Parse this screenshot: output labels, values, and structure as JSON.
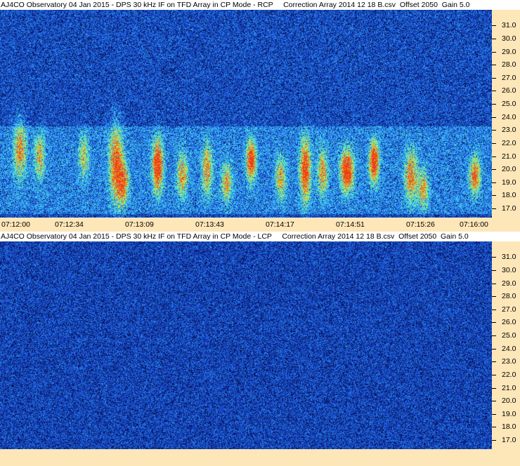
{
  "chart_data": [
    {
      "type": "heatmap",
      "title": "AJ4CO Observatory 04 Jan 2015 - DPS 30 kHz IF on TFD Array in CP Mode - RCP     Correction Array 2014 12 18 B.csv  Offset 2050  Gain 5.0",
      "xlabel": "",
      "ylabel": "",
      "x_ticks": [
        "07:12:00",
        "07:12:34",
        "07:13:09",
        "07:13:43",
        "07:14:17",
        "07:14:51",
        "07:15:26",
        "07:16:00"
      ],
      "y_ticks": [
        "31.0",
        "30.0",
        "29.0",
        "28.0",
        "27.0",
        "26.0",
        "25.0",
        "24.0",
        "23.0",
        "22.0",
        "21.0",
        "20.0",
        "19.0",
        "18.0",
        "17.0"
      ],
      "xlim": [
        "07:12:00",
        "07:16:00"
      ],
      "ylim": [
        16.3,
        32.2
      ],
      "colors": {
        "background": "#0c1a5e",
        "mid": "#1f6fe0",
        "high": "#46e3ff",
        "peak": "#f0b020"
      },
      "emission_band": [
        17.0,
        23.0
      ],
      "bursts": [
        {
          "t": 0.04,
          "f": 21.5,
          "strength": 0.6,
          "width": 0.012,
          "spread": 2.0
        },
        {
          "t": 0.08,
          "f": 21.0,
          "strength": 0.5,
          "width": 0.01,
          "spread": 1.6
        },
        {
          "t": 0.17,
          "f": 21.0,
          "strength": 0.45,
          "width": 0.01,
          "spread": 1.5
        },
        {
          "t": 0.235,
          "f": 20.5,
          "strength": 0.75,
          "width": 0.012,
          "spread": 2.6
        },
        {
          "t": 0.25,
          "f": 19.0,
          "strength": 0.65,
          "width": 0.01,
          "spread": 1.6
        },
        {
          "t": 0.32,
          "f": 20.3,
          "strength": 0.95,
          "width": 0.01,
          "spread": 1.8
        },
        {
          "t": 0.37,
          "f": 19.6,
          "strength": 0.6,
          "width": 0.01,
          "spread": 1.5
        },
        {
          "t": 0.42,
          "f": 20.0,
          "strength": 0.6,
          "width": 0.01,
          "spread": 1.8
        },
        {
          "t": 0.46,
          "f": 19.0,
          "strength": 0.55,
          "width": 0.01,
          "spread": 1.4
        },
        {
          "t": 0.51,
          "f": 20.7,
          "strength": 0.9,
          "width": 0.009,
          "spread": 1.4
        },
        {
          "t": 0.57,
          "f": 19.3,
          "strength": 0.55,
          "width": 0.01,
          "spread": 1.5
        },
        {
          "t": 0.62,
          "f": 20.0,
          "strength": 0.85,
          "width": 0.01,
          "spread": 2.2
        },
        {
          "t": 0.655,
          "f": 19.8,
          "strength": 0.6,
          "width": 0.01,
          "spread": 1.6
        },
        {
          "t": 0.705,
          "f": 19.9,
          "strength": 1.0,
          "width": 0.012,
          "spread": 1.4
        },
        {
          "t": 0.76,
          "f": 20.6,
          "strength": 1.0,
          "width": 0.009,
          "spread": 1.4
        },
        {
          "t": 0.835,
          "f": 19.5,
          "strength": 0.65,
          "width": 0.012,
          "spread": 1.8
        },
        {
          "t": 0.86,
          "f": 18.5,
          "strength": 0.55,
          "width": 0.01,
          "spread": 1.3
        },
        {
          "t": 0.965,
          "f": 19.5,
          "strength": 0.75,
          "width": 0.01,
          "spread": 1.3
        }
      ]
    },
    {
      "type": "heatmap",
      "title": "AJ4CO Observatory 04 Jan 2015 - DPS 30 kHz IF on TFD Array in CP Mode - LCP     Correction Array 2014 12 18 B.csv  Offset 2050  Gain 5.0",
      "xlabel": "",
      "ylabel": "",
      "x_ticks": [],
      "y_ticks": [
        "31.0",
        "30.0",
        "29.0",
        "28.0",
        "27.0",
        "26.0",
        "25.0",
        "24.0",
        "23.0",
        "22.0",
        "21.0",
        "20.0",
        "19.0",
        "18.0",
        "17.0"
      ],
      "ylim": [
        16.3,
        32.2
      ],
      "colors": {
        "background": "#0c1a5e",
        "mid": "#1f6fe0",
        "high": "#46e3ff"
      },
      "bursts": []
    }
  ]
}
